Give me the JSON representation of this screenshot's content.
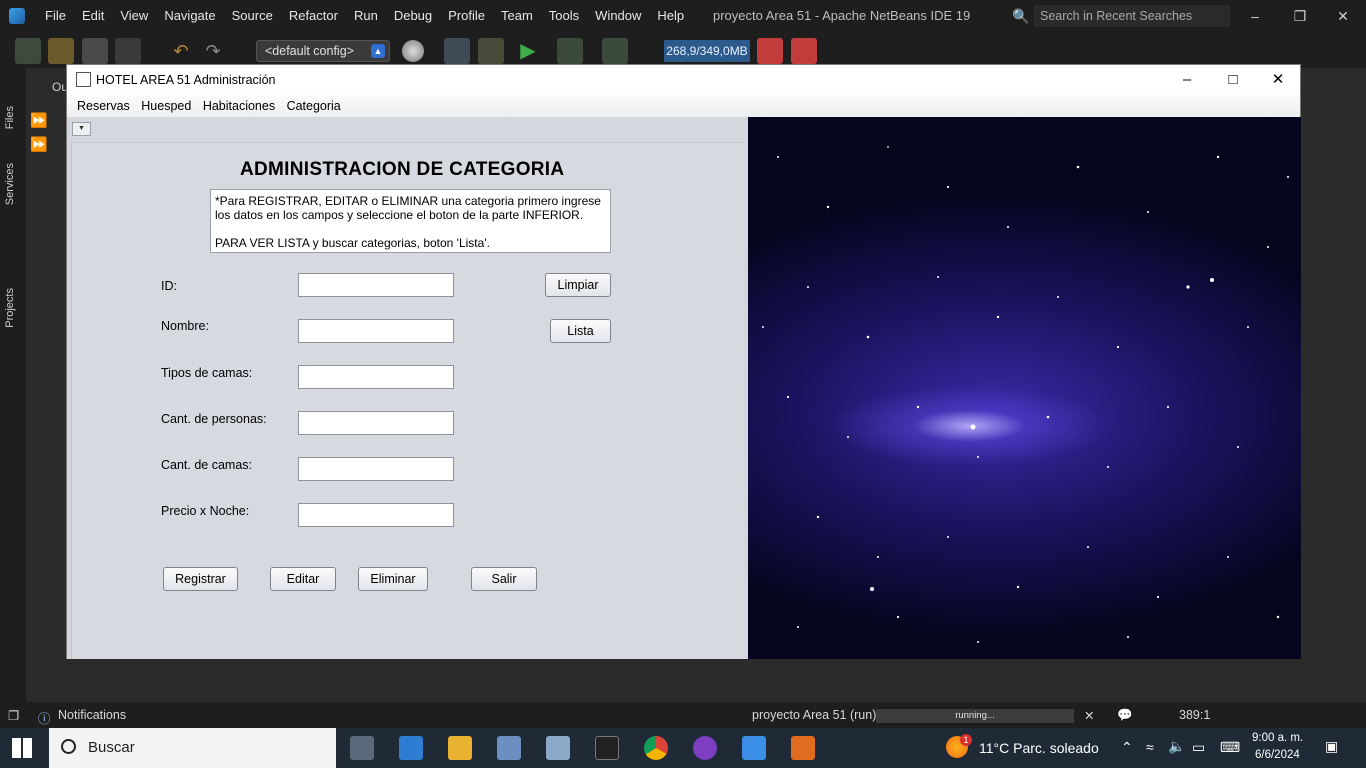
{
  "ide": {
    "menu": [
      "File",
      "Edit",
      "View",
      "Navigate",
      "Source",
      "Refactor",
      "Run",
      "Debug",
      "Profile",
      "Team",
      "Tools",
      "Window",
      "Help"
    ],
    "title": "proyecto Area 51 - Apache NetBeans IDE 19",
    "search_placeholder": "Search in Recent Searches (Ctrl+I)",
    "config_select": "<default config>",
    "memory": "268,9/349,0MB",
    "sidebar_labels": {
      "files": "Files",
      "services": "Services",
      "projects": "Projects"
    },
    "tab_fragment": "Ou",
    "status": {
      "notifications": "Notifications",
      "run_label": "proyecto Area 51 (run)",
      "progress_text": "running...",
      "position": "389:1"
    }
  },
  "app": {
    "title": "HOTEL AREA 51 Administración",
    "menu": [
      "Reservas",
      "Huesped",
      "Habitaciones",
      "Categoria"
    ],
    "heading": "ADMINISTRACION DE CATEGORIA",
    "info_line1": "*Para REGISTRAR, EDITAR o ELIMINAR una categoria primero ingrese",
    "info_line2": "los datos en los campos y seleccione el boton de la parte INFERIOR.",
    "info_line3": "PARA VER LISTA y buscar categorias, boton 'Lista'.",
    "fields": [
      {
        "label": "ID:",
        "value": ""
      },
      {
        "label": "Nombre:",
        "value": ""
      },
      {
        "label": "Tipos de camas:",
        "value": ""
      },
      {
        "label": "Cant. de personas:",
        "value": ""
      },
      {
        "label": "Cant. de camas:",
        "value": ""
      },
      {
        "label": "Precio x Noche:",
        "value": ""
      }
    ],
    "buttons": {
      "limpiar": "Limpiar",
      "lista": "Lista",
      "registrar": "Registrar",
      "editar": "Editar",
      "eliminar": "Eliminar",
      "salir": "Salir"
    }
  },
  "taskbar": {
    "search": "Buscar",
    "weather": "11°C  Parc. soleado",
    "time": "9:00 a. m.",
    "date": "6/6/2024",
    "weather_badge": "1"
  }
}
